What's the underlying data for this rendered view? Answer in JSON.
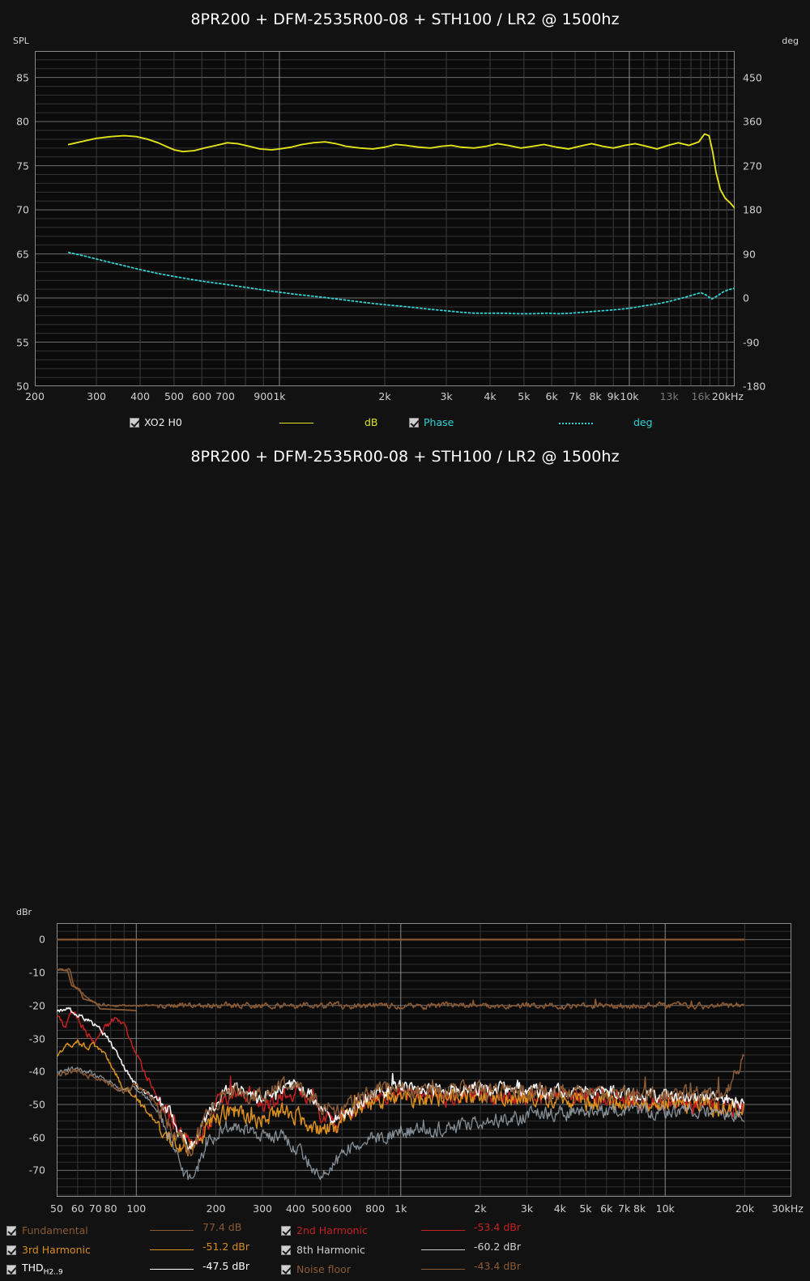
{
  "charts": [
    {
      "id": "spl-phase",
      "title": "8PR200 + DFM-2535R00-08 + STH100 / LR2 @ 1500hz",
      "left_axis_label": "SPL",
      "right_axis_label": "deg",
      "legend": [
        {
          "label": "XO2 H0",
          "units": "dB",
          "color": "#e2e21a",
          "line": "solid",
          "checked": true
        },
        {
          "label": "Phase",
          "units": "deg",
          "color": "#2fd4d4",
          "line": "dotted",
          "checked": true
        }
      ]
    },
    {
      "id": "distortion",
      "title": "8PR200 + DFM-2535R00-08 + STH100 / LR2 @ 1500hz",
      "left_axis_label": "dBr",
      "legend": [
        {
          "label": "Fundamental",
          "value": "77.4 dB",
          "color": "#8a5a34",
          "checked": true
        },
        {
          "label": "2nd Harmonic",
          "value": "-53.4 dBr",
          "color": "#c42020",
          "checked": true
        },
        {
          "label": "3rd Harmonic",
          "value": "-51.2 dBr",
          "color": "#d98e1e",
          "checked": true
        },
        {
          "label": "8th Harmonic",
          "value": "-60.2 dBr",
          "color": "#c9c9c9",
          "checked": true
        },
        {
          "label": "THD",
          "sublabel": "H2..9",
          "value": "-47.5 dBr",
          "color": "#ffffff",
          "checked": true
        },
        {
          "label": "Noise floor",
          "value": "-43.4 dBr",
          "color": "#8a5a34",
          "checked": true
        }
      ]
    }
  ],
  "chart_data": [
    {
      "type": "line",
      "id": "spl-phase",
      "title": "8PR200 + DFM-2535R00-08 + STH100 / LR2 @ 1500hz",
      "xlabel": "",
      "ylabel": "SPL",
      "ylabel_right": "deg",
      "xscale": "log",
      "xlim": [
        200,
        20000
      ],
      "ylim": [
        50,
        88
      ],
      "ylim_right": [
        -180,
        504
      ],
      "grid": true,
      "legend_position": "below",
      "xticks": [
        200,
        300,
        400,
        500,
        600,
        700,
        900,
        1000,
        2000,
        3000,
        4000,
        5000,
        6000,
        7000,
        8000,
        9000,
        10000,
        13000,
        16000,
        20000
      ],
      "xticklabels": [
        "200",
        "300",
        "400",
        "500",
        "600",
        "700",
        "900",
        "1k",
        "2k",
        "3k",
        "4k",
        "5k",
        "6k",
        "7k",
        "8k",
        "9k",
        "10k",
        "13k",
        "16k",
        "20kHz"
      ],
      "yticks": [
        50,
        55,
        60,
        65,
        70,
        75,
        80,
        85
      ],
      "yticks_right": [
        -180,
        -90,
        0,
        90,
        180,
        270,
        360,
        450
      ],
      "series": [
        {
          "name": "XO2 H0",
          "unit": "dB",
          "axis": "left",
          "color": "#e2e21a",
          "x": [
            250,
            270,
            300,
            330,
            360,
            390,
            420,
            450,
            480,
            500,
            530,
            570,
            610,
            660,
            710,
            760,
            820,
            880,
            950,
            1000,
            1080,
            1160,
            1250,
            1350,
            1450,
            1550,
            1700,
            1850,
            2000,
            2150,
            2300,
            2500,
            2700,
            2900,
            3100,
            3300,
            3600,
            3900,
            4200,
            4500,
            4900,
            5300,
            5700,
            6200,
            6700,
            7200,
            7800,
            8400,
            9000,
            9700,
            10400,
            11200,
            12000,
            12900,
            13800,
            14800,
            15800,
            16400,
            16900,
            17300,
            17700,
            18200,
            18800,
            19400,
            20000
          ],
          "y": [
            77.4,
            77.7,
            78.1,
            78.3,
            78.4,
            78.3,
            78.0,
            77.6,
            77.1,
            76.8,
            76.6,
            76.7,
            77.0,
            77.3,
            77.6,
            77.5,
            77.2,
            76.9,
            76.8,
            76.9,
            77.1,
            77.4,
            77.6,
            77.7,
            77.5,
            77.2,
            77.0,
            76.9,
            77.1,
            77.4,
            77.3,
            77.1,
            77.0,
            77.2,
            77.3,
            77.1,
            77.0,
            77.2,
            77.5,
            77.3,
            77.0,
            77.2,
            77.4,
            77.1,
            76.9,
            77.2,
            77.5,
            77.2,
            77.0,
            77.3,
            77.5,
            77.2,
            76.9,
            77.3,
            77.6,
            77.3,
            77.7,
            78.6,
            78.4,
            76.6,
            74.2,
            72.3,
            71.3,
            70.8,
            70.2
          ]
        },
        {
          "name": "Phase",
          "unit": "deg",
          "axis": "right",
          "color": "#2fd4d4",
          "x": [
            250,
            280,
            310,
            350,
            400,
            450,
            500,
            560,
            620,
            700,
            780,
            870,
            950,
            1000,
            1100,
            1200,
            1350,
            1500,
            1700,
            1900,
            2100,
            2400,
            2700,
            3000,
            3300,
            3600,
            4000,
            4400,
            4800,
            5300,
            5800,
            6300,
            6800,
            7400,
            8000,
            8700,
            9400,
            10200,
            11000,
            12000,
            13000,
            14000,
            15000,
            16000,
            16600,
            17200,
            17800,
            18500,
            19200,
            20000
          ],
          "y": [
            93,
            85,
            77,
            68,
            58,
            50,
            44,
            38,
            33,
            28,
            23,
            18,
            14,
            12,
            8,
            5,
            1,
            -3,
            -8,
            -12,
            -15,
            -19,
            -23,
            -26,
            -29,
            -31,
            -31,
            -31,
            -32,
            -32,
            -31,
            -32,
            -31,
            -29,
            -27,
            -25,
            -23,
            -20,
            -16,
            -12,
            -7,
            -1,
            5,
            11,
            6,
            -2,
            4,
            12,
            17,
            20
          ]
        }
      ]
    },
    {
      "type": "line",
      "id": "distortion",
      "title": "8PR200 + DFM-2535R00-08 + STH100 / LR2 @ 1500hz",
      "xlabel": "",
      "ylabel": "dBr",
      "xscale": "log",
      "xlim": [
        50,
        30000
      ],
      "ylim": [
        -78,
        5
      ],
      "grid": true,
      "legend_position": "below",
      "xticks": [
        50,
        60,
        70,
        80,
        100,
        200,
        300,
        400,
        500,
        600,
        800,
        1000,
        2000,
        3000,
        4000,
        5000,
        6000,
        7000,
        8000,
        10000,
        20000,
        30000
      ],
      "xticklabels": [
        "50",
        "60",
        "70",
        "80",
        "100",
        "200",
        "300",
        "400",
        "500",
        "600",
        "800",
        "1k",
        "2k",
        "3k",
        "4k",
        "5k",
        "6k",
        "7k",
        "8k",
        "10k",
        "20k",
        "30kHz"
      ],
      "yticks": [
        0,
        -10,
        -20,
        -30,
        -40,
        -50,
        -60,
        -70
      ],
      "series": [
        {
          "name": "Fundamental",
          "value": "77.4 dB",
          "color": "#8a5a34",
          "level_dbr": 0
        },
        {
          "name": "2nd Harmonic",
          "value": "-53.4 dBr",
          "color": "#c42020"
        },
        {
          "name": "3rd Harmonic",
          "value": "-51.2 dBr",
          "color": "#d98e1e"
        },
        {
          "name": "8th Harmonic",
          "value": "-60.2 dBr",
          "color": "#c9c9c9"
        },
        {
          "name": "THD H2..9",
          "value": "-47.5 dBr",
          "color": "#ffffff"
        },
        {
          "name": "Noise floor",
          "value": "-43.4 dBr",
          "color": "#8a5a34"
        }
      ]
    }
  ]
}
